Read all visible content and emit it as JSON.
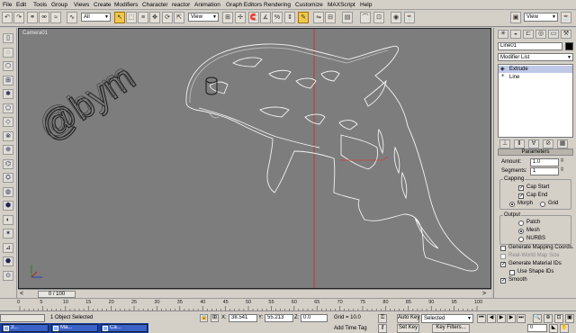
{
  "menu": [
    "File",
    "Edit",
    "Tools",
    "Group",
    "Views",
    "Create",
    "Modifiers",
    "Character",
    "reactor",
    "Animation",
    "Graph Editors",
    "Rendering",
    "Customize",
    "MAXScript",
    "Help"
  ],
  "toolbar": {
    "selection_filter": "All",
    "ref_coord": "View",
    "view_right": "View"
  },
  "viewport": {
    "label": "Camera01",
    "watermark": "@bym"
  },
  "panel": {
    "object_name": "Line01",
    "modifier_list": "Modifier List",
    "stack": [
      "Extrude",
      "Line"
    ],
    "parameters_title": "Parameters",
    "amount_label": "Amount:",
    "amount_value": "1.0",
    "segments_label": "Segments:",
    "segments_value": "1",
    "capping_title": "Capping",
    "cap_start": "Cap Start",
    "cap_end": "Cap End",
    "morph": "Morph",
    "grid": "Grid",
    "output_title": "Output",
    "patch": "Patch",
    "mesh": "Mesh",
    "nurbs": "NURBS",
    "gen_mapping": "Generate Mapping Coords.",
    "real_world": "Real-World Map Size",
    "gen_material": "Generate Material IDs",
    "use_shape": "Use Shape IDs",
    "smooth": "Smooth"
  },
  "timeline": {
    "slider": "0 / 100",
    "ticks": [
      "0",
      "5",
      "10",
      "15",
      "20",
      "25",
      "30",
      "35",
      "40",
      "45",
      "50",
      "55",
      "60",
      "65",
      "70",
      "75",
      "80",
      "85",
      "90",
      "95",
      "100"
    ]
  },
  "status": {
    "selected": "1 Object Selected",
    "x_label": "X:",
    "x_value": "38.541",
    "y_label": "Y:",
    "y_value": "55.213",
    "z_label": "Z:",
    "z_value": "0.0",
    "grid": "Grid = 10.0",
    "add_time_tag": "Add Time Tag",
    "auto_key": "Auto Key",
    "set_key": "Set Key",
    "key_selected": "Selected",
    "key_filters": "Key Filters...",
    "frame": "0"
  },
  "taskbar": [
    "3...",
    "Ma...",
    "Ca..."
  ]
}
